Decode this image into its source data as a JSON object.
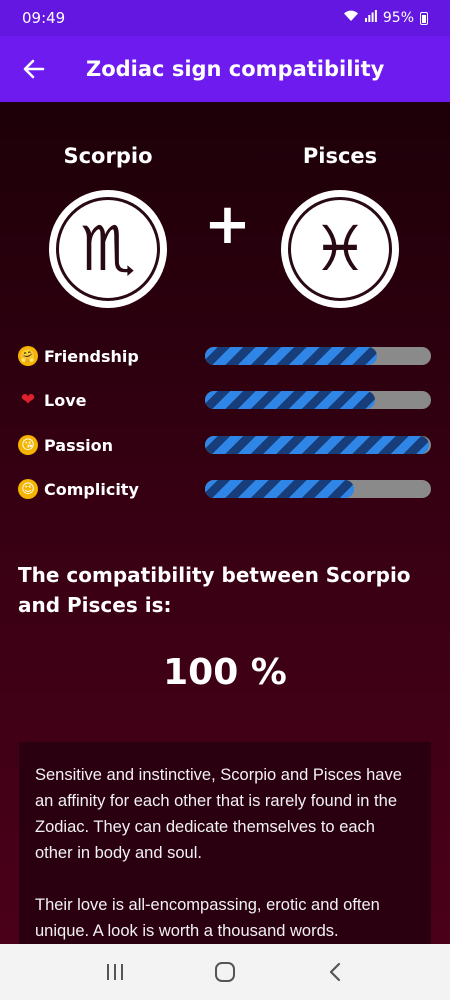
{
  "status_bar": {
    "time": "09:49",
    "signal_icon": "signal-icon",
    "wifi_icon": "wifi-icon",
    "battery_percent": "95%",
    "battery_icon": "battery-icon"
  },
  "app_bar": {
    "title": "Zodiac sign compatibility",
    "back_icon": "arrow-left-icon",
    "background": "#6e1bf0"
  },
  "signs": {
    "left": {
      "name": "Scorpio",
      "symbol": "♏",
      "icon": "scorpio-icon"
    },
    "plus": "+",
    "right": {
      "name": "Pisces",
      "symbol": "♓",
      "icon": "pisces-icon"
    }
  },
  "meters": [
    {
      "label": "Friendship",
      "emoji": "🤗",
      "emoji_bg": "#f5b400",
      "fill": 0.76
    },
    {
      "label": "Love",
      "emoji": "❤",
      "emoji_bg": "transparent",
      "fill": 0.75
    },
    {
      "label": "Passion",
      "emoji": "😘",
      "emoji_bg": "#f5b400",
      "fill": 0.99
    },
    {
      "label": "Complicity",
      "emoji": "😉",
      "emoji_bg": "#f5b400",
      "fill": 0.66
    }
  ],
  "meter_colors": {
    "stripe_light": "#2f86e6",
    "stripe_dark": "#173e7a",
    "track": "#8a8a8a"
  },
  "compatibility": {
    "heading": "The compatibility between Scorpio and Pisces is:",
    "value": "100 %"
  },
  "description": {
    "paragraph_1": "Sensitive and instinctive, Scorpio and Pisces have an affinity for each other that is rarely found in the Zodiac. They can dedicate themselves to each other in body and soul.",
    "paragraph_2": "Their love is all-encompassing, erotic and often unique. A look is worth a thousand words."
  },
  "nav_bar": {
    "recents_icon": "recents-icon",
    "home_icon": "home-icon",
    "back_icon": "back-chevron-icon"
  }
}
